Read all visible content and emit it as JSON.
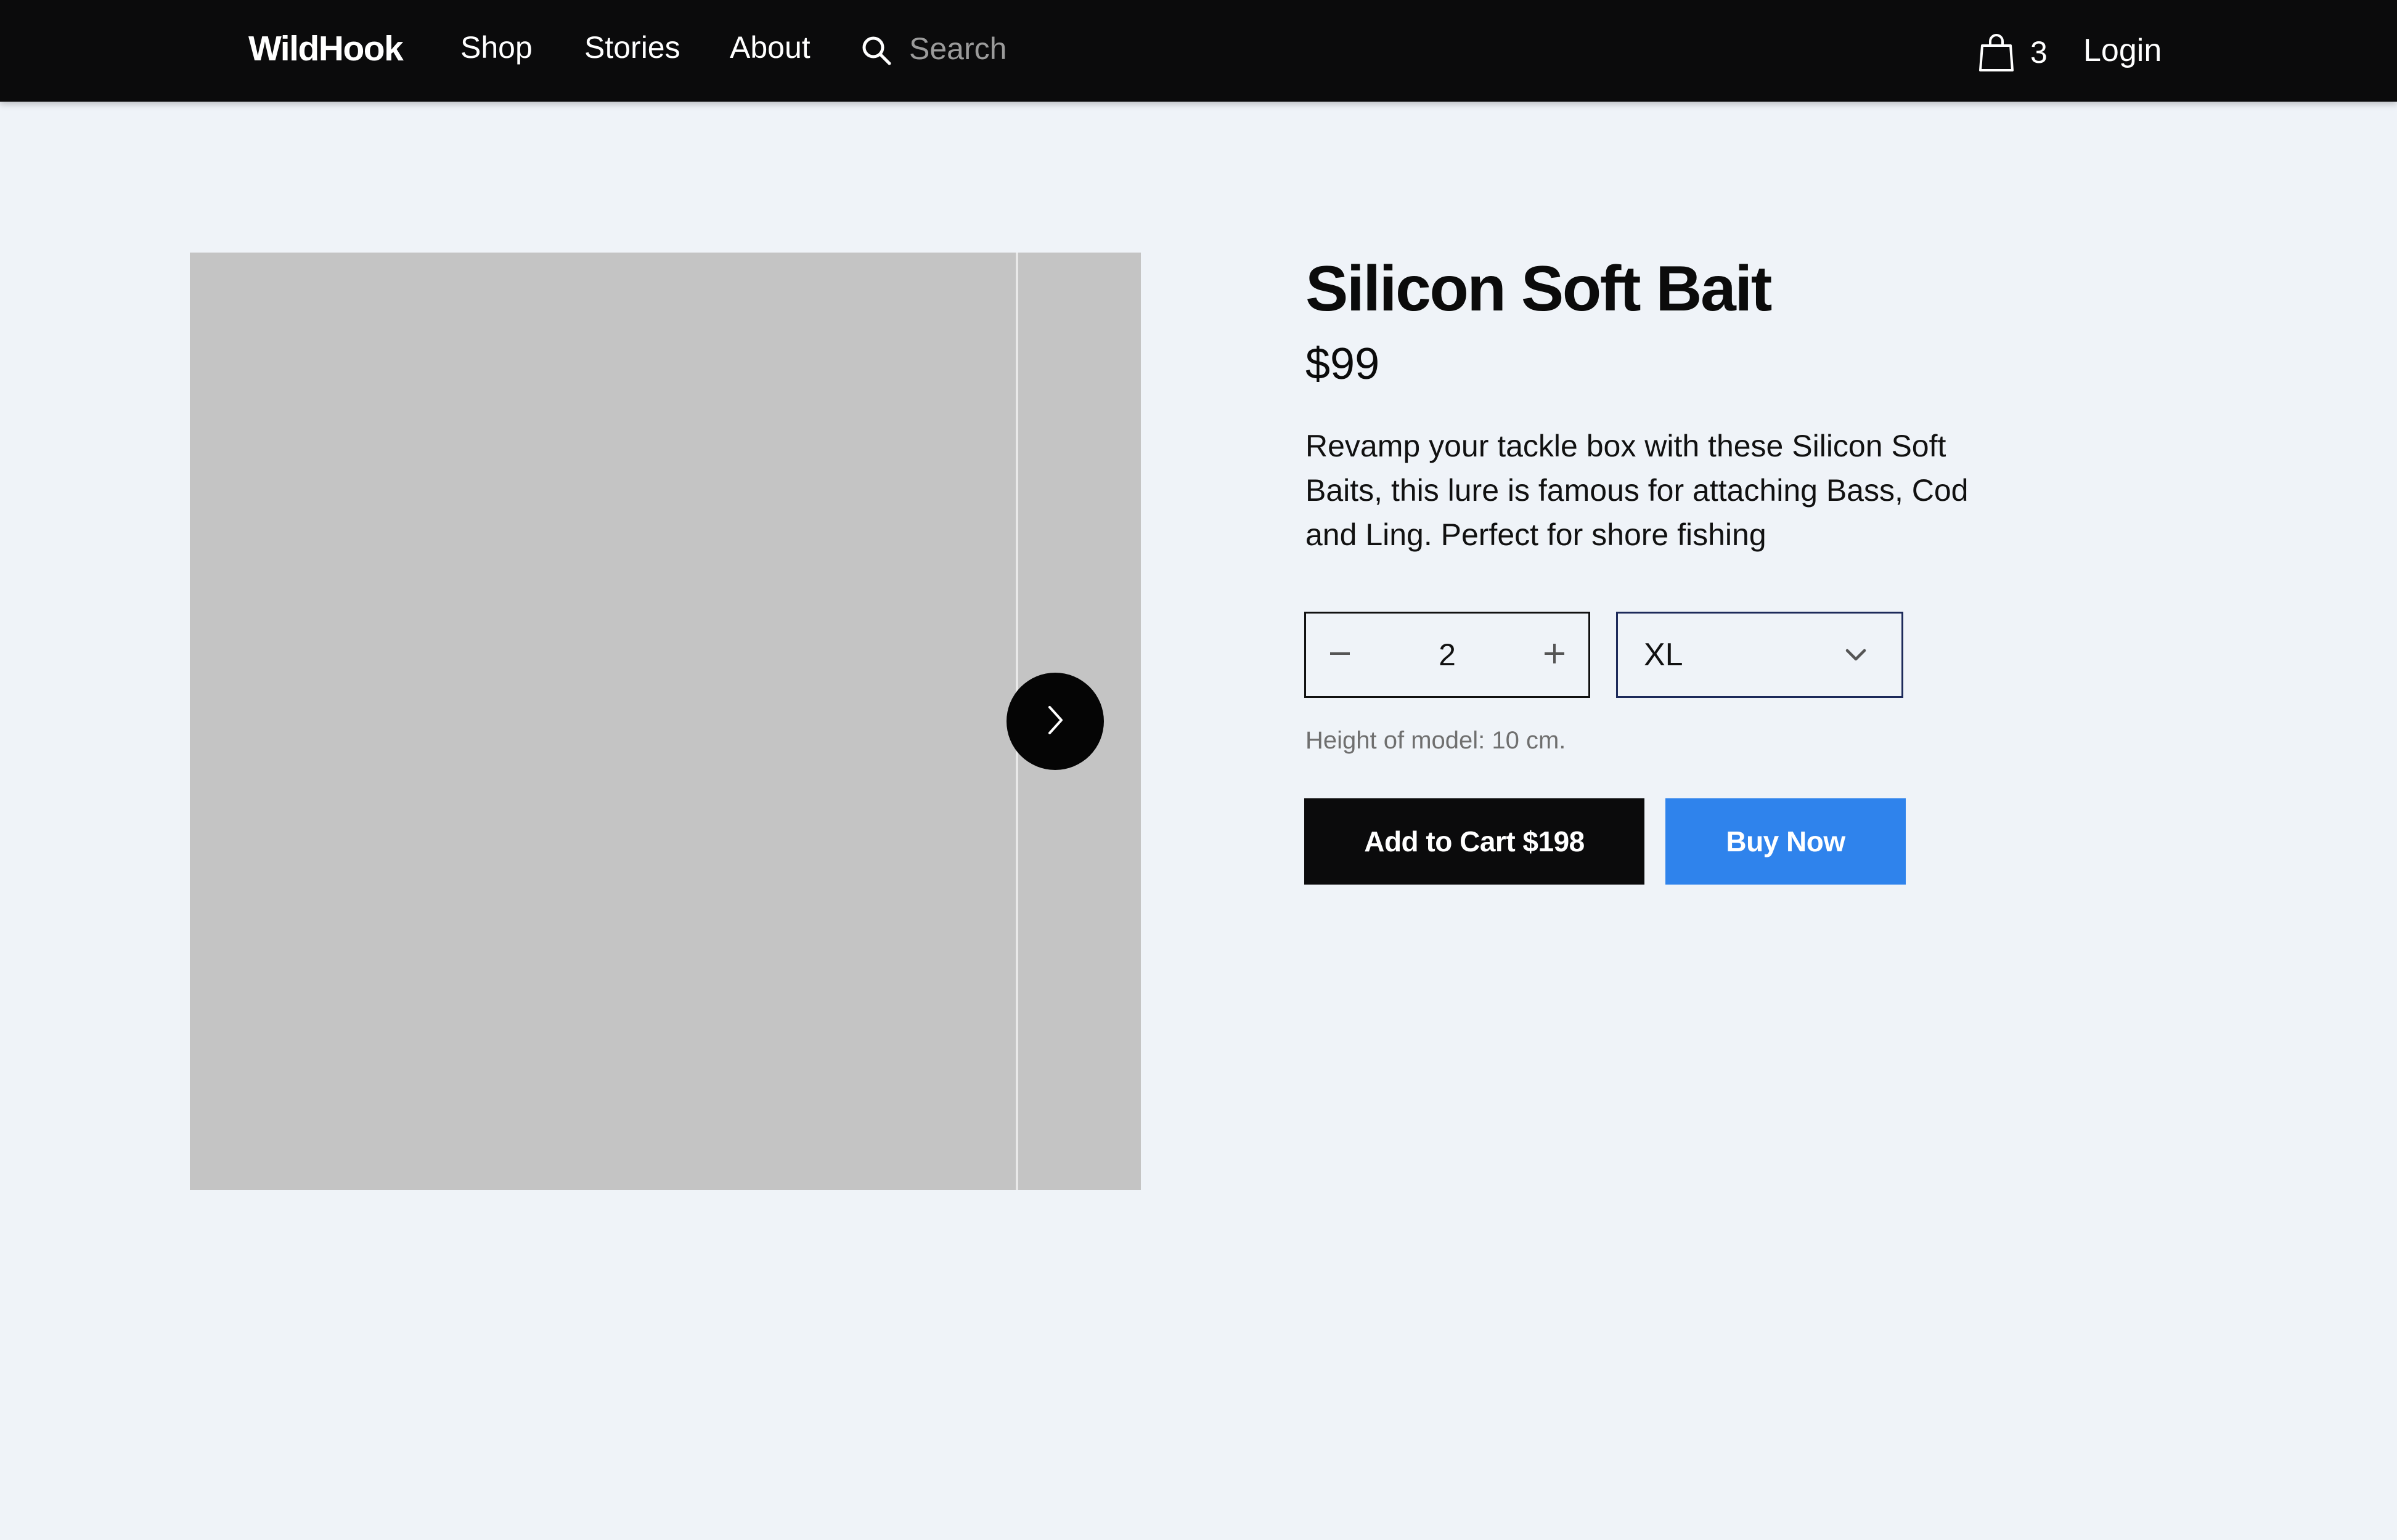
{
  "header": {
    "brand": "WildHook",
    "nav": [
      {
        "label": "Shop"
      },
      {
        "label": "Stories"
      },
      {
        "label": "About"
      }
    ],
    "search": {
      "placeholder": "Search",
      "value": "",
      "icon": "search-icon"
    },
    "cart": {
      "count": "3",
      "icon": "shopping-bag-icon"
    },
    "login_label": "Login"
  },
  "gallery": {
    "next_icon": "chevron-right-icon"
  },
  "product": {
    "title": "Silicon Soft Bait",
    "price": "$99",
    "description": "Revamp your tackle box with these Silicon Soft Baits, this lure is famous for attaching Bass, Cod and Ling. Perfect for shore fishing",
    "quantity": "2",
    "size": "XL",
    "model_note": "Height of model: 10 cm.",
    "add_to_cart_label": "Add to Cart $198",
    "buy_now_label": "Buy Now"
  },
  "colors": {
    "header_bg": "#0b0b0c",
    "page_bg": "#eff3f8",
    "image_placeholder": "#c4c4c4",
    "primary_button": "#0b0b0c",
    "accent_button": "#2f83ec",
    "select_border": "#1d2a5a"
  }
}
